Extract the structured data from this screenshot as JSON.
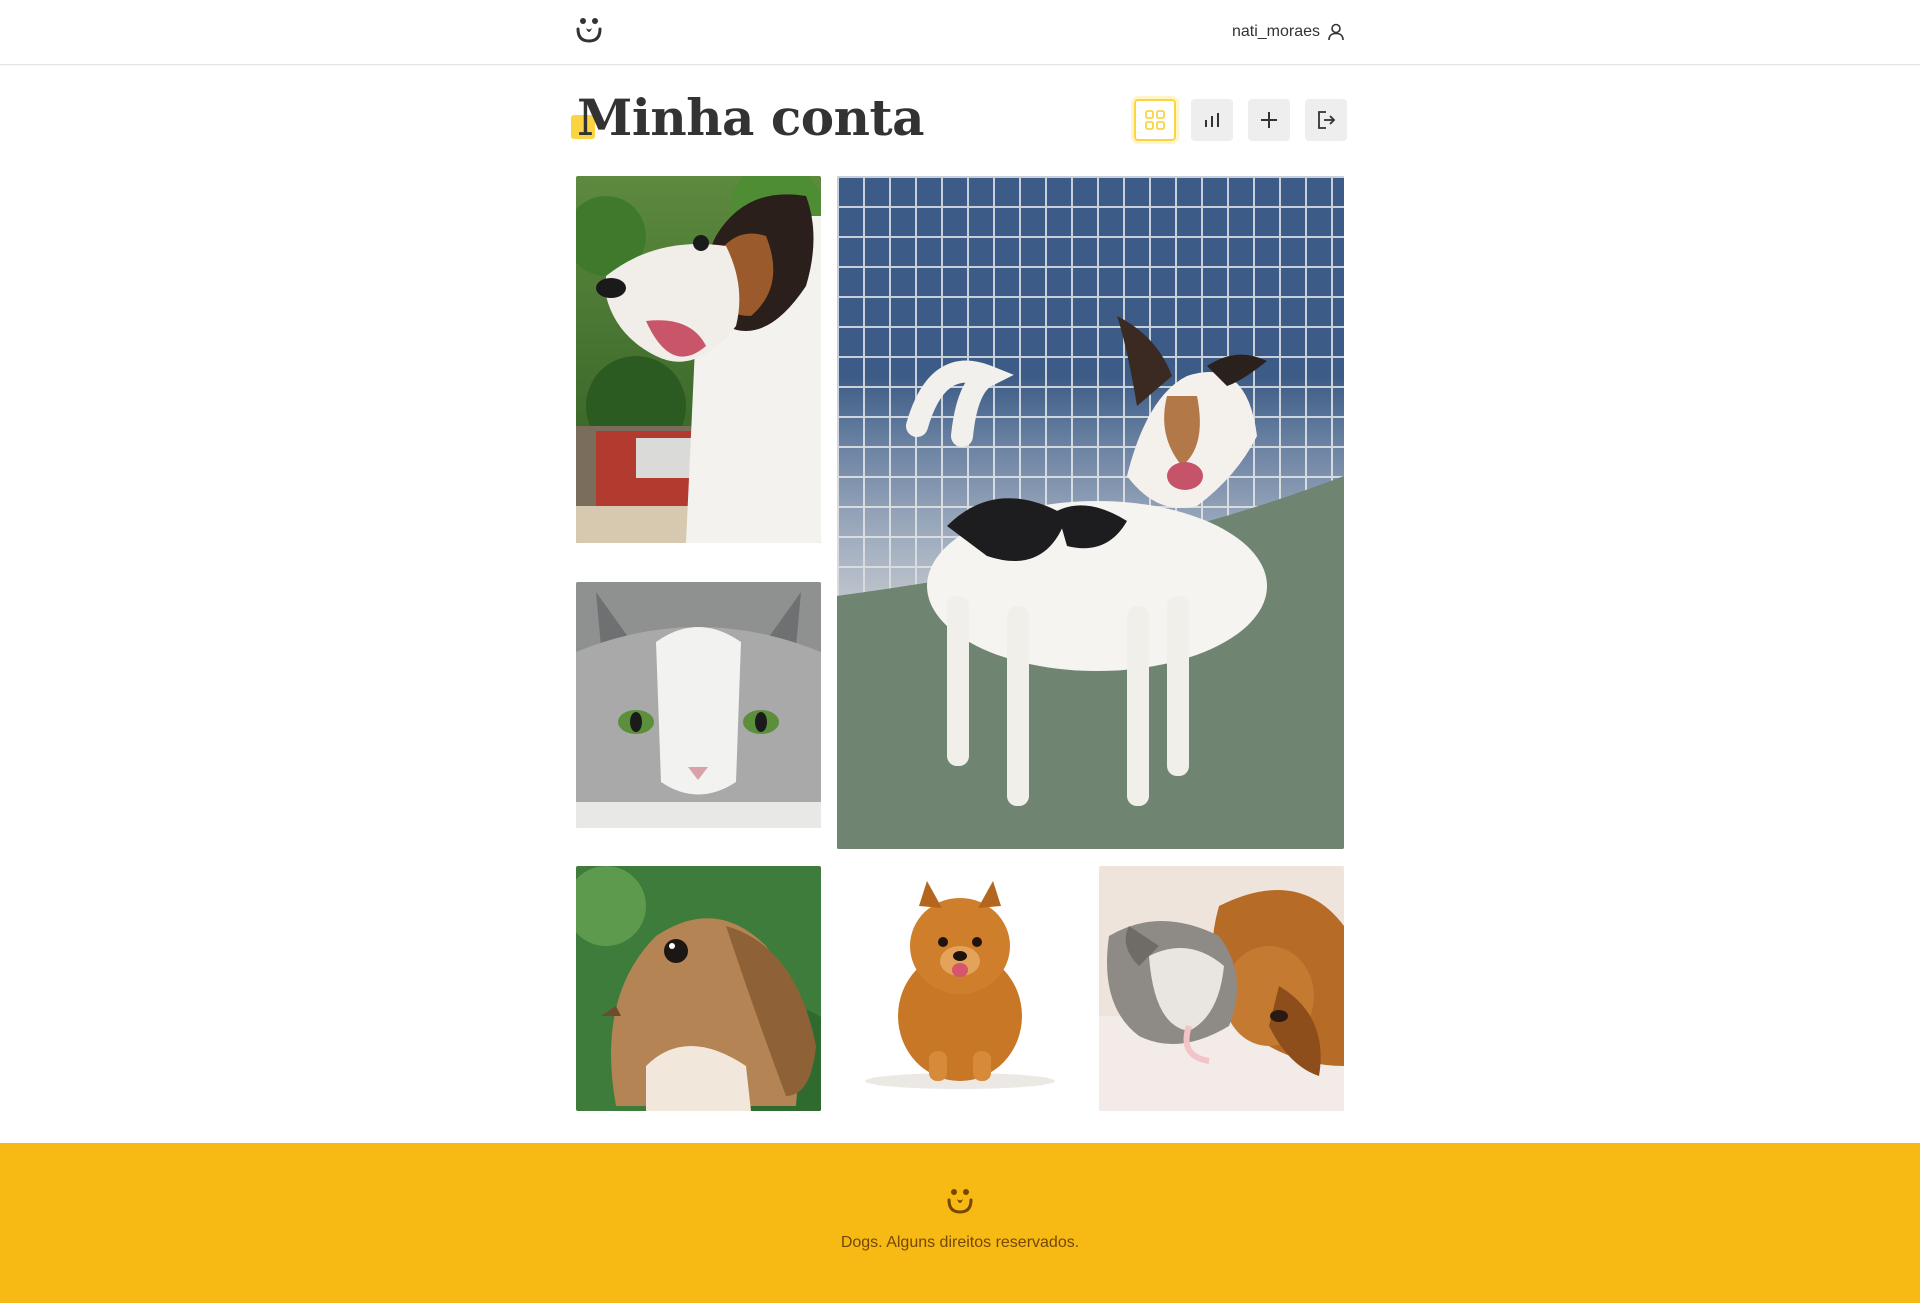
{
  "header": {
    "logo_icon": "dog-face-logo-icon",
    "username": "nati_moraes",
    "user_icon": "user-icon"
  },
  "page": {
    "title": "Minha conta",
    "accent_color": "#fbd441"
  },
  "nav": [
    {
      "name": "grid-icon",
      "active": true
    },
    {
      "name": "bar-chart-icon",
      "active": false
    },
    {
      "name": "plus-icon",
      "active": false
    },
    {
      "name": "logout-icon",
      "active": false
    }
  ],
  "feed": {
    "photos": [
      {
        "subject": "dog-laughing-outdoors"
      },
      {
        "subject": "dog-standing-on-court"
      },
      {
        "subject": "gray-white-cat"
      },
      {
        "subject": "brown-rabbit"
      },
      {
        "subject": "pomeranian-dog"
      },
      {
        "subject": "puppy-and-kitten-sleeping"
      }
    ]
  },
  "footer": {
    "logo_icon": "dog-face-logo-icon",
    "text": "Dogs. Alguns direitos reservados.",
    "background": "#f7b914"
  }
}
